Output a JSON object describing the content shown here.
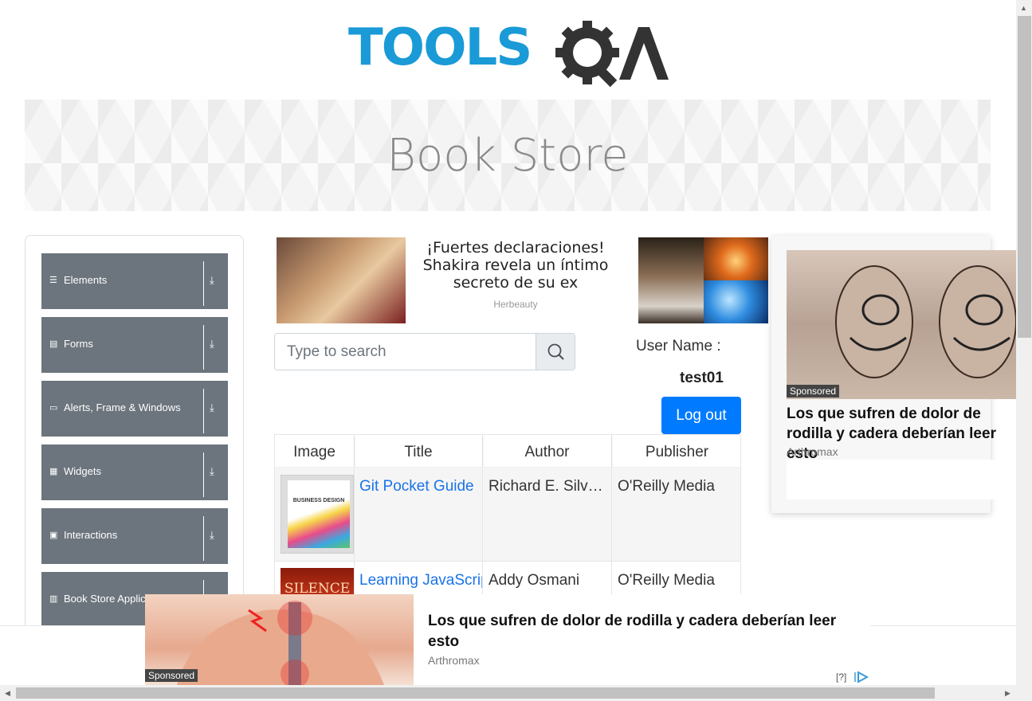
{
  "header": {
    "logo_text": "TOOLS",
    "logo_suffix": "QA"
  },
  "banner": {
    "title": "Book Store"
  },
  "sidebar": {
    "items": [
      {
        "label": "Elements",
        "icon": "menu-icon"
      },
      {
        "label": "Forms",
        "icon": "form-icon"
      },
      {
        "label": "Alerts, Frame & Windows",
        "icon": "window-icon"
      },
      {
        "label": "Widgets",
        "icon": "grid-icon"
      },
      {
        "label": "Interactions",
        "icon": "interaction-icon"
      },
      {
        "label": "Book Store Applica",
        "icon": "books-icon"
      }
    ]
  },
  "ad_top": {
    "headline": "¡Fuertes declaraciones! Shakira revela un íntimo secreto de su ex",
    "source": "Herbeauty"
  },
  "search": {
    "placeholder": "Type to search"
  },
  "user": {
    "label": "User Name :",
    "value": "test01",
    "logout_label": "Log out"
  },
  "table": {
    "headers": [
      "Image",
      "Title",
      "Author",
      "Publisher"
    ],
    "rows": [
      {
        "cover_text": "BUSINESS DESIGN",
        "title": "Git Pocket Guide",
        "author": "Richard E. Silverman",
        "publisher": "O'Reilly Media"
      },
      {
        "cover_text": "SILENCE",
        "title": "Learning JavaScript Design Patterns",
        "author": "Addy Osmani",
        "publisher": "O'Reilly Media"
      }
    ]
  },
  "ad_right": {
    "sponsored": "Sponsored",
    "headline": "Los que sufren de dolor de rodilla y cadera deberían leer esto",
    "source": "Arthromax"
  },
  "ad_bottom": {
    "sponsored": "Sponsored",
    "headline": "Los que sufren de dolor de rodilla y cadera deberían leer esto",
    "source": "Arthromax",
    "help": "[?]"
  },
  "colors": {
    "brand_blue": "#1a9ad6",
    "logo_dark": "#333333",
    "sidebar_bg": "#6c757d",
    "primary_button": "#007bff",
    "link": "#1a73e8"
  }
}
